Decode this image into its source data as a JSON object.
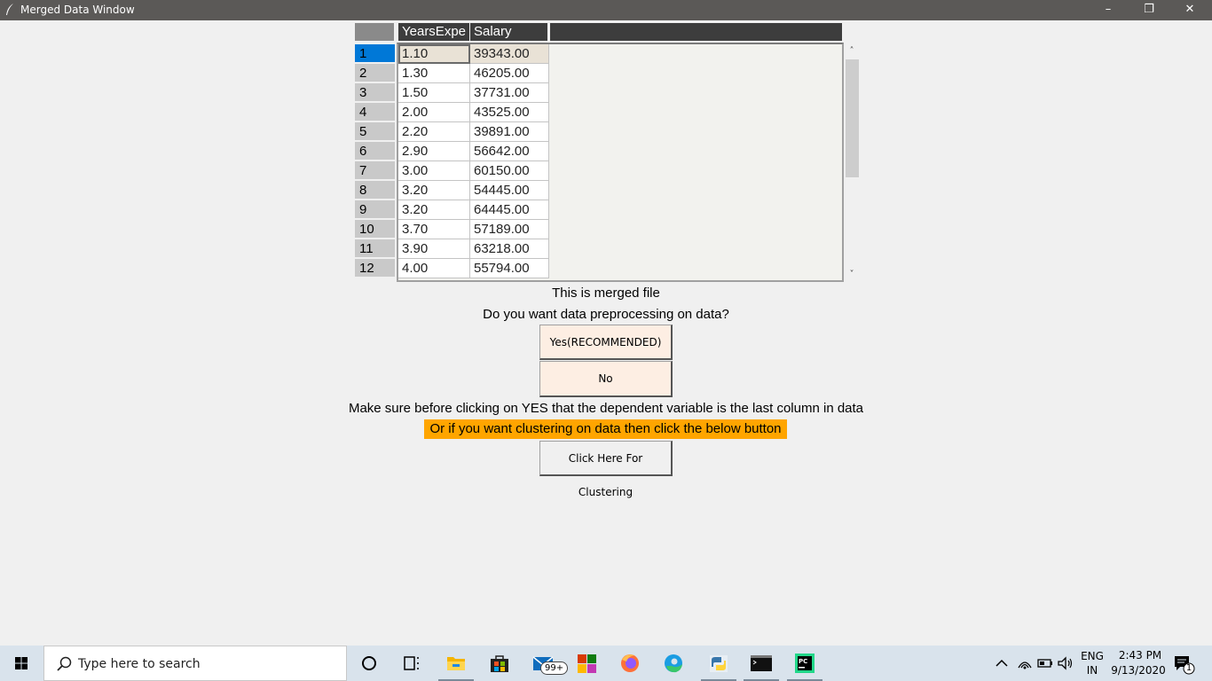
{
  "window": {
    "title": "Merged Data Window",
    "controls": {
      "minimize": "–",
      "maximize": "❐",
      "close": "✕"
    }
  },
  "table": {
    "columns": [
      "YearsExpe",
      "Salary"
    ],
    "rows": [
      {
        "index": "1",
        "years": "1.10",
        "salary": "39343.00"
      },
      {
        "index": "2",
        "years": "1.30",
        "salary": "46205.00"
      },
      {
        "index": "3",
        "years": "1.50",
        "salary": "37731.00"
      },
      {
        "index": "4",
        "years": "2.00",
        "salary": "43525.00"
      },
      {
        "index": "5",
        "years": "2.20",
        "salary": "39891.00"
      },
      {
        "index": "6",
        "years": "2.90",
        "salary": "56642.00"
      },
      {
        "index": "7",
        "years": "3.00",
        "salary": "60150.00"
      },
      {
        "index": "8",
        "years": "3.20",
        "salary": "54445.00"
      },
      {
        "index": "9",
        "years": "3.20",
        "salary": "64445.00"
      },
      {
        "index": "10",
        "years": "3.70",
        "salary": "57189.00"
      },
      {
        "index": "11",
        "years": "3.90",
        "salary": "63218.00"
      },
      {
        "index": "12",
        "years": "4.00",
        "salary": "55794.00"
      }
    ],
    "scroll": {
      "up": "˄",
      "down": "˅"
    }
  },
  "messages": {
    "merged": "This is merged file",
    "question": "Do you want data preprocessing on data?",
    "note": "Make sure before clicking on YES that the dependent variable is the last column in data",
    "clustering_note": "Or if you want clustering on data then click the below button"
  },
  "buttons": {
    "yes": "Yes(RECOMMENDED)",
    "no": "No",
    "cluster": "Click Here For Clustering"
  },
  "taskbar": {
    "search_placeholder": "Type here to search",
    "mail_badge": "99+",
    "language": "ENG",
    "region": "IN",
    "time": "2:43 PM",
    "date": "9/13/2020",
    "notification_count": "1"
  },
  "colors": {
    "titlebar": "#5b5957",
    "selected_row": "#0078d7",
    "highlight": "#ffa500",
    "button_bg": "#fdeee3"
  }
}
